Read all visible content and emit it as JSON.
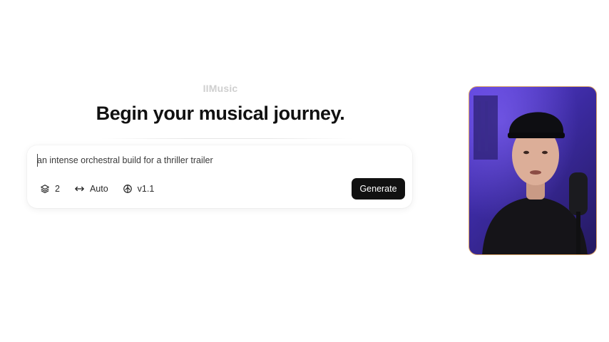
{
  "app": {
    "brand": "IIMusic"
  },
  "hero": {
    "headline": "Begin your musical journey."
  },
  "composer": {
    "prompt_value": "an intense orchestral build for a thriller trailer",
    "controls": {
      "count_label": "2",
      "duration_label": "Auto",
      "version_label": "v1.1"
    },
    "generate_label": "Generate"
  },
  "colors": {
    "accent": "#111111",
    "brand_text": "#cfcfcf",
    "video_bg": "#4a33c4"
  },
  "icons": [
    "layers-icon",
    "horizontal-arrows-icon",
    "model-version-icon"
  ]
}
